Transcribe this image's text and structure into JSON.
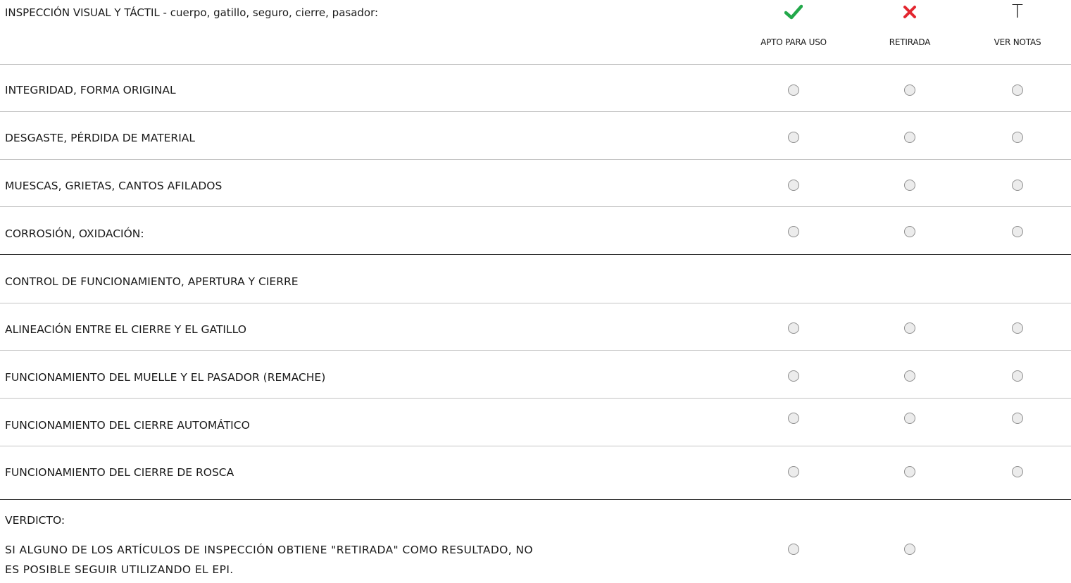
{
  "header": {
    "title": "INSPECCIÓN VISUAL Y TÁCTIL - cuerpo, gatillo, seguro, cierre, pasador:",
    "columns": [
      {
        "icon": "check-icon",
        "color": "#22a84a",
        "label": "APTO PARA USO"
      },
      {
        "icon": "cross-icon",
        "color": "#e3262f",
        "label": "RETIRADA"
      },
      {
        "icon": "text-t-icon",
        "glyph": "T",
        "label": "VER NOTAS"
      }
    ]
  },
  "section1": {
    "rows": [
      {
        "label": "INTEGRIDAD, FORMA ORIGINAL"
      },
      {
        "label": "DESGASTE, PÉRDIDA DE MATERIAL"
      },
      {
        "label": "MUESCAS, GRIETAS, CANTOS AFILADOS"
      },
      {
        "label": "CORROSIÓN, OXIDACIÓN:"
      }
    ]
  },
  "section2": {
    "title": "CONTROL DE FUNCIONAMIENTO, APERTURA Y CIERRE",
    "rows": [
      {
        "label": "ALINEACIÓN ENTRE EL CIERRE Y EL GATILLO"
      },
      {
        "label": "FUNCIONAMIENTO DEL MUELLE Y EL PASADOR (REMACHE)"
      },
      {
        "label": "FUNCIONAMIENTO DEL CIERRE AUTOMÁTICO"
      },
      {
        "label": "FUNCIONAMIENTO DEL CIERRE DE ROSCA"
      }
    ]
  },
  "verdict": {
    "title": "VERDICTO:",
    "text": "SI ALGUNO DE LOS ARTÍCULOS DE INSPECCIÓN OBTIENE \"RETIRADA\" COMO RESULTADO, NO ES POSIBLE SEGUIR UTILIZANDO EL EPI."
  }
}
